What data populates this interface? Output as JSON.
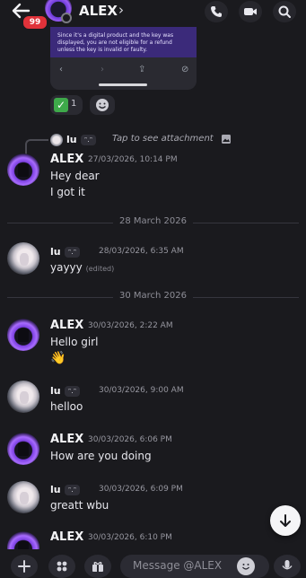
{
  "header": {
    "title": "ALEX",
    "unread_badge": "99",
    "icons": [
      "back-arrow-icon",
      "call-icon",
      "video-icon",
      "search-icon"
    ]
  },
  "attachment": {
    "text": "Since it's a digital product and the key was displayed, you are not eligible for a refund unless the key is invalid or faulty."
  },
  "reactions": [
    {
      "icon": "check-mark-emoji",
      "count": "1"
    },
    {
      "icon": "add-reaction-icon"
    }
  ],
  "reply": {
    "user": "lu",
    "text": "Tap to see attachment"
  },
  "date_dividers": [
    "28 March 2026",
    "30 March 2026"
  ],
  "messages": [
    {
      "user": "ALEX",
      "time": "27/03/2026, 10:14 PM",
      "lines": [
        "Hey dear",
        "I got it"
      ]
    },
    {
      "user": "lu",
      "tag": "ᵔ.ᵔ",
      "time": "28/03/2026, 6:35 AM",
      "lines": [
        "yayyy"
      ],
      "edited": "(edited)"
    },
    {
      "user": "ALEX",
      "time": "30/03/2026, 2:22 AM",
      "lines": [
        "Hello girl",
        "👋"
      ]
    },
    {
      "user": "lu",
      "tag": "ᵔ.ᵔ",
      "time": "30/03/2026, 9:00 AM",
      "lines": [
        "helloo"
      ]
    },
    {
      "user": "ALEX",
      "time": "30/03/2026, 6:06 PM",
      "lines": [
        "How are you doing"
      ]
    },
    {
      "user": "lu",
      "tag": "ᵔ.ᵔ",
      "time": "30/03/2026, 6:09 PM",
      "lines": [
        "greatt wbu"
      ]
    },
    {
      "user": "ALEX",
      "time": "30/03/2026, 6:10 PM",
      "lines": []
    }
  ],
  "composer": {
    "placeholder": "Message @ALEX"
  },
  "colors": {
    "background": "#1a1a1e",
    "badge": "#e0323a",
    "accent_purple": "#7b3fe0"
  }
}
